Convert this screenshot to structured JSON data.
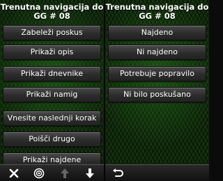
{
  "left_screen": {
    "title_line1": "Trenutna navigacija do",
    "title_line2": "GG # 08",
    "menu": [
      "Zabeleži poskus",
      "Prikaži opis",
      "Prikaži dnevnike",
      "Prikaži namig",
      "Vnesite naslednji korak",
      "Poišči drugo",
      "Prikaži najdene"
    ],
    "toolbar_icons": [
      "close-icon",
      "target-icon",
      "arrow-up-icon",
      "arrow-down-icon"
    ]
  },
  "right_screen": {
    "title_line1": "Trenutna navigacija do",
    "title_line2": "GG # 08",
    "menu": [
      "Najdeno",
      "Ni najdeno",
      "Potrebuje popravilo",
      "Ni bilo poskušano"
    ],
    "toolbar_icons": [
      "back-icon"
    ]
  },
  "colors": {
    "background_green": "#15330f",
    "button_dark": "#2c2c2c",
    "text": "#ffffff"
  }
}
